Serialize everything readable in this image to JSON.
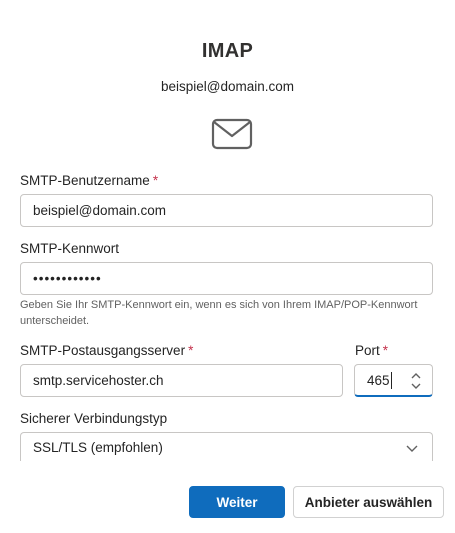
{
  "header": {
    "title": "IMAP",
    "account": "beispiel@domain.com",
    "icon": "mail-icon"
  },
  "form": {
    "username": {
      "label": "SMTP-Benutzername",
      "required_mark": "*",
      "value": "beispiel@domain.com"
    },
    "password": {
      "label": "SMTP-Kennwort",
      "value": "••••••••••••",
      "hint": "Geben Sie Ihr SMTP-Kennwort ein, wenn es sich von Ihrem IMAP/POP-Kennwort unterscheidet."
    },
    "server": {
      "label": "SMTP-Postausgangsserver",
      "required_mark": "*",
      "value": "smtp.servicehoster.ch"
    },
    "port": {
      "label": "Port",
      "required_mark": "*",
      "value": "465"
    },
    "security": {
      "label": "Sicherer Verbindungstyp",
      "value": "SSL/TLS (empfohlen)"
    }
  },
  "buttons": {
    "next": "Weiter",
    "choose_provider": "Anbieter auswählen"
  },
  "colors": {
    "accent": "#0f6cbd",
    "required": "#c4314b"
  }
}
